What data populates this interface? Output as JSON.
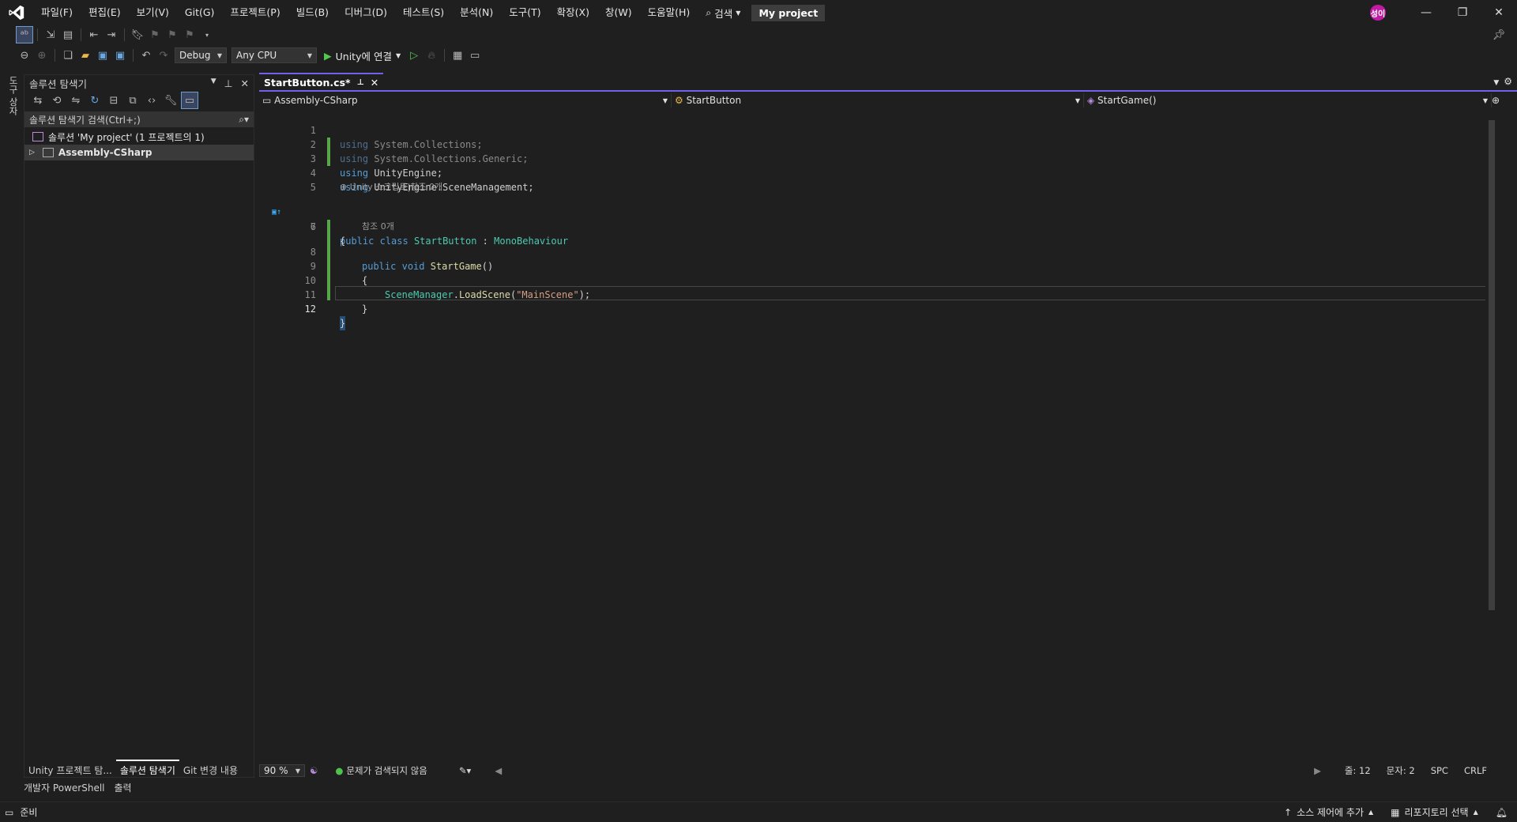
{
  "menu": {
    "items": [
      "파일(F)",
      "편집(E)",
      "보기(V)",
      "Git(G)",
      "프로젝트(P)",
      "빌드(B)",
      "디버그(D)",
      "테스트(S)",
      "분석(N)",
      "도구(T)",
      "확장(X)",
      "창(W)",
      "도움말(H)"
    ],
    "search_label": "검색",
    "project_title": "My project",
    "avatar_initial": "성이"
  },
  "toolbar": {
    "configuration": "Debug",
    "platform": "Any CPU",
    "run_label": "Unity에 연결"
  },
  "left_strip": {
    "tab_label": "도구 상자"
  },
  "solution_explorer": {
    "title": "솔루션 탐색기",
    "search_placeholder": "솔루션 탐색기 검색(Ctrl+;)",
    "solution_label": "솔루션 'My project' (1 프로젝트의 1)",
    "project_label": "Assembly-CSharp",
    "bottom_tabs": [
      "Unity 프로젝트 탐...",
      "솔루션 탐색기",
      "Git 변경 내용"
    ]
  },
  "editor": {
    "tab_label": "StartButton.cs*",
    "nav": {
      "project": "Assembly-CSharp",
      "class": "StartButton",
      "member": "StartGame()"
    },
    "line_numbers": [
      "1",
      "2",
      "3",
      "4",
      "5",
      "6",
      "7",
      "8",
      "9",
      "10",
      "11",
      "12"
    ],
    "code": {
      "l1_kw": "using",
      "l1_ns": " System.Collections;",
      "l2_kw": "using",
      "l2_ns": " System.Collections.Generic;",
      "l3_kw": "using",
      "l3_ns": " UnityEngine;",
      "l4_kw": "using",
      "l4_ns": " UnityEngine.SceneManagement;",
      "lens_class": "Unity 스크립트|참조 0개",
      "l6_kw1": "public",
      "l6_kw2": "class",
      "l6_name": "StartButton",
      "l6_sep": " : ",
      "l6_base": "MonoBehaviour",
      "l7": "{",
      "lens_method": "참조 0개",
      "l8_kw1": "public",
      "l8_kw2": "void",
      "l8_name": "StartGame",
      "l8_paren": "()",
      "l9": "{",
      "l10_type": "SceneManager",
      "l10_dot": ".",
      "l10_fn": "LoadScene",
      "l10_open": "(",
      "l10_str": "\"MainScene\"",
      "l10_close": ");",
      "l11": "}",
      "l12": "}"
    },
    "status": {
      "zoom": "90 %",
      "issues": "문제가 검색되지 않음",
      "line": "줄: 12",
      "col": "문자: 2",
      "spc": "SPC",
      "eol": "CRLF"
    }
  },
  "bottom_panel_tabs": [
    "개발자 PowerShell",
    "출력"
  ],
  "statusbar": {
    "ready": "준비",
    "source_control": "소스 제어에 추가",
    "repository": "리포지토리 선택"
  }
}
